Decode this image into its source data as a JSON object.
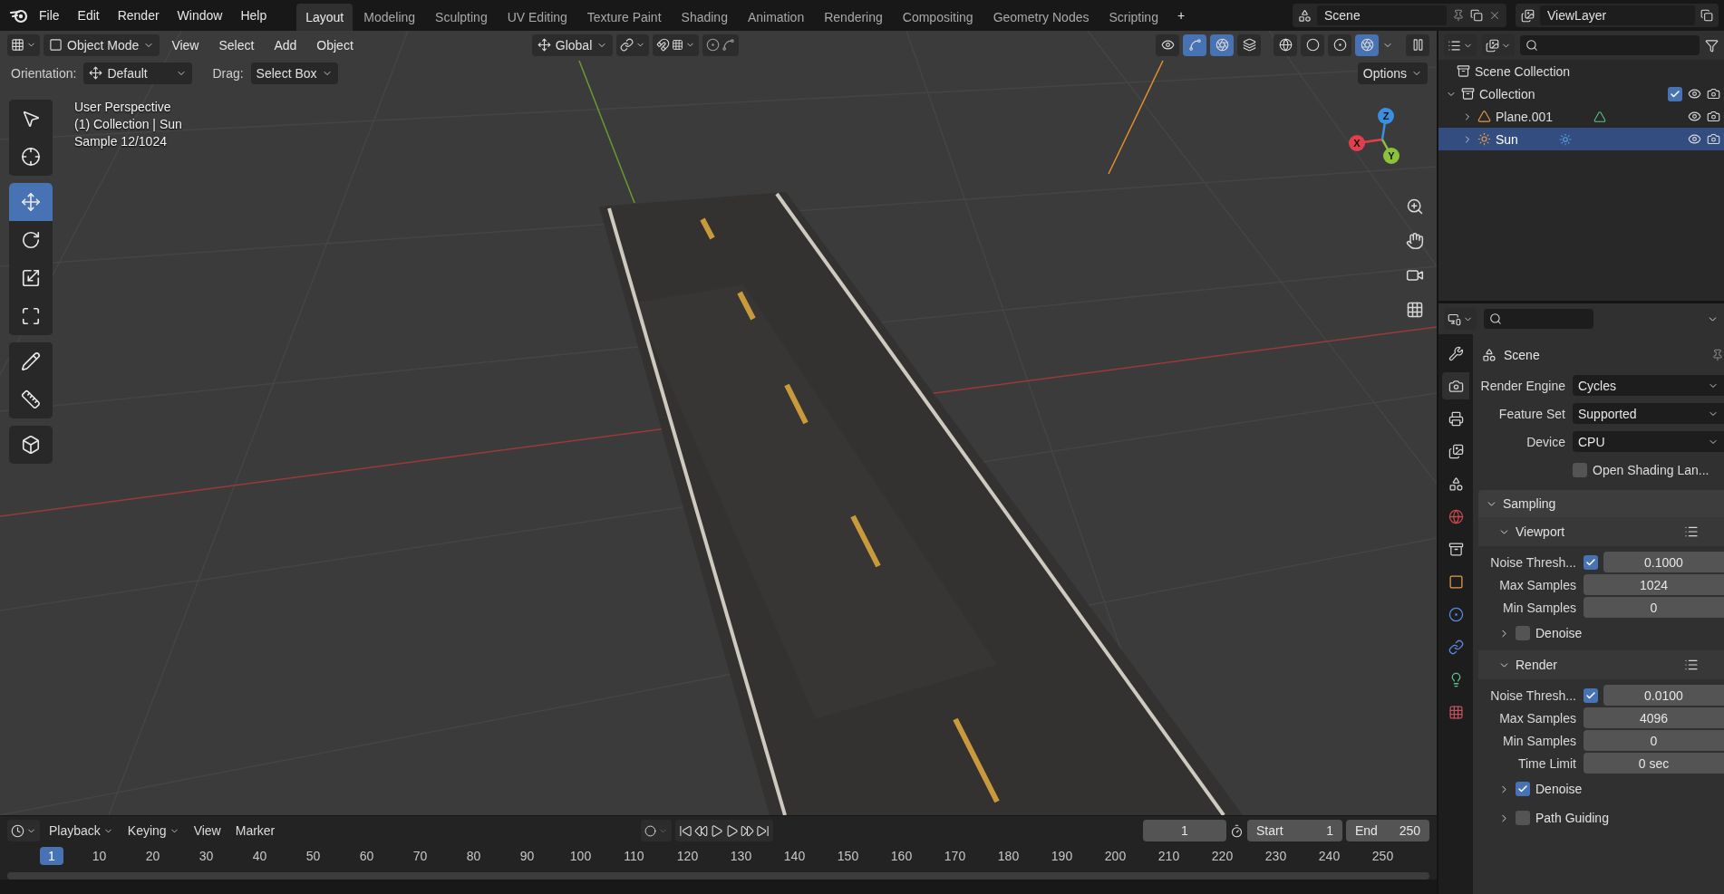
{
  "menu": [
    "File",
    "Edit",
    "Render",
    "Window",
    "Help"
  ],
  "workspaces": [
    {
      "label": "Layout",
      "selected": true
    },
    {
      "label": "Modeling",
      "selected": false
    },
    {
      "label": "Sculpting",
      "selected": false
    },
    {
      "label": "UV Editing",
      "selected": false
    },
    {
      "label": "Texture Paint",
      "selected": false
    },
    {
      "label": "Shading",
      "selected": false
    },
    {
      "label": "Animation",
      "selected": false
    },
    {
      "label": "Rendering",
      "selected": false
    },
    {
      "label": "Compositing",
      "selected": false
    },
    {
      "label": "Geometry Nodes",
      "selected": false
    },
    {
      "label": "Scripting",
      "selected": false
    }
  ],
  "add_workspace": "+",
  "scene": "Scene",
  "view_layer": "ViewLayer",
  "viewport": {
    "mode": "Object Mode",
    "menus": [
      "View",
      "Select",
      "Add",
      "Object"
    ],
    "transform": "Global",
    "toggles": [
      {
        "kind": "visibility",
        "on": false
      },
      {
        "kind": "gizmo",
        "on": true
      },
      {
        "kind": "overlays",
        "on": true
      },
      {
        "kind": "xray",
        "on": false
      }
    ],
    "shading": [
      {
        "kind": "wireframe",
        "selected": false
      },
      {
        "kind": "solid",
        "selected": false
      },
      {
        "kind": "material",
        "selected": false
      },
      {
        "kind": "rendered",
        "selected": true
      }
    ],
    "orientation_label": "Orientation:",
    "orientation": "Default",
    "drag_label": "Drag:",
    "drag": "Select Box",
    "options": "Options",
    "tool_groups": [
      {
        "tools": [
          {
            "kind": "select",
            "selected": false
          },
          {
            "kind": "cursor",
            "selected": false
          }
        ]
      },
      {
        "tools": [
          {
            "kind": "move",
            "selected": true
          },
          {
            "kind": "rotate",
            "selected": false
          },
          {
            "kind": "scale",
            "selected": false
          },
          {
            "kind": "transform",
            "selected": false
          }
        ]
      },
      {
        "tools": [
          {
            "kind": "annotate",
            "selected": false
          },
          {
            "kind": "measure",
            "selected": false
          }
        ]
      },
      {
        "tools": [
          {
            "kind": "add-cube",
            "selected": false
          }
        ]
      }
    ],
    "info": [
      "User Perspective",
      "(1) Collection | Sun",
      "Sample 12/1024"
    ],
    "axes": [
      {
        "label": "X",
        "color": "#e0404e"
      },
      {
        "label": "Y",
        "color": "#8bc43a"
      },
      {
        "label": "Z",
        "color": "#3b8ee0"
      }
    ]
  },
  "outliner": {
    "root": "Scene Collection",
    "items": [
      {
        "label": "Collection",
        "kind": "collection",
        "checked": true,
        "expanded": true,
        "selected": false,
        "children": [
          {
            "label": "Plane.001",
            "kind": "mesh",
            "expanded": false,
            "selected": false
          },
          {
            "label": "Sun",
            "kind": "light",
            "expanded": false,
            "selected": true
          }
        ]
      }
    ]
  },
  "properties": {
    "tabs": [
      {
        "kind": "tool",
        "selected": false
      },
      {
        "kind": "render",
        "selected": true
      },
      {
        "kind": "output",
        "selected": false
      },
      {
        "kind": "view-layer",
        "selected": false
      },
      {
        "kind": "scene",
        "selected": false
      },
      {
        "kind": "world",
        "selected": false
      },
      {
        "kind": "collection",
        "selected": false
      },
      {
        "kind": "object",
        "selected": false
      },
      {
        "kind": "physics",
        "selected": false
      },
      {
        "kind": "constraints",
        "selected": false
      },
      {
        "kind": "data",
        "selected": false
      },
      {
        "kind": "texture",
        "selected": false
      }
    ],
    "title": "Scene",
    "fields": [
      {
        "kind": "dropdown",
        "label": "Render Engine",
        "value": "Cycles"
      },
      {
        "kind": "dropdown",
        "label": "Feature Set",
        "value": "Supported"
      },
      {
        "kind": "dropdown",
        "label": "Device",
        "value": "CPU"
      },
      {
        "kind": "checkbox",
        "label": "Open Shading Lan...",
        "checked": false
      }
    ],
    "panel": {
      "title": "Sampling",
      "expanded": true,
      "subpanels": [
        {
          "title": "Viewport",
          "expanded": true,
          "rows": [
            {
              "kind": "check-number",
              "label": "Noise Thresh...",
              "checked": true,
              "value": "0.1000"
            },
            {
              "kind": "number",
              "label": "Max Samples",
              "value": "1024"
            },
            {
              "kind": "number",
              "label": "Min Samples",
              "value": "0"
            }
          ],
          "children": [
            {
              "title": "Denoise",
              "expanded": false,
              "checked": false
            }
          ]
        },
        {
          "title": "Render",
          "expanded": true,
          "rows": [
            {
              "kind": "check-number",
              "label": "Noise Thresh...",
              "checked": true,
              "value": "0.0100"
            },
            {
              "kind": "number",
              "label": "Max Samples",
              "value": "4096"
            },
            {
              "kind": "number",
              "label": "Min Samples",
              "value": "0"
            },
            {
              "kind": "number",
              "label": "Time Limit",
              "value": "0 sec"
            }
          ],
          "children": [
            {
              "title": "Denoise",
              "expanded": false,
              "checked": true
            },
            {
              "title": "Path Guiding",
              "expanded": false,
              "checked": false
            }
          ]
        }
      ]
    }
  },
  "timeline": {
    "menus": [
      "Playback",
      "Keying",
      "View",
      "Marker"
    ],
    "current_frame": "1",
    "start_label": "Start",
    "start": "1",
    "end_label": "End",
    "end": "250",
    "ruler": [
      {
        "label": "1",
        "selected": true
      },
      {
        "label": "10",
        "selected": false
      },
      {
        "label": "20",
        "selected": false
      },
      {
        "label": "30",
        "selected": false
      },
      {
        "label": "40",
        "selected": false
      },
      {
        "label": "50",
        "selected": false
      },
      {
        "label": "60",
        "selected": false
      },
      {
        "label": "70",
        "selected": false
      },
      {
        "label": "80",
        "selected": false
      },
      {
        "label": "90",
        "selected": false
      },
      {
        "label": "100",
        "selected": false
      },
      {
        "label": "110",
        "selected": false
      },
      {
        "label": "120",
        "selected": false
      },
      {
        "label": "130",
        "selected": false
      },
      {
        "label": "140",
        "selected": false
      },
      {
        "label": "150",
        "selected": false
      },
      {
        "label": "160",
        "selected": false
      },
      {
        "label": "170",
        "selected": false
      },
      {
        "label": "180",
        "selected": false
      },
      {
        "label": "190",
        "selected": false
      },
      {
        "label": "200",
        "selected": false
      },
      {
        "label": "210",
        "selected": false
      },
      {
        "label": "220",
        "selected": false
      },
      {
        "label": "230",
        "selected": false
      },
      {
        "label": "240",
        "selected": false
      },
      {
        "label": "250",
        "selected": false
      }
    ]
  }
}
